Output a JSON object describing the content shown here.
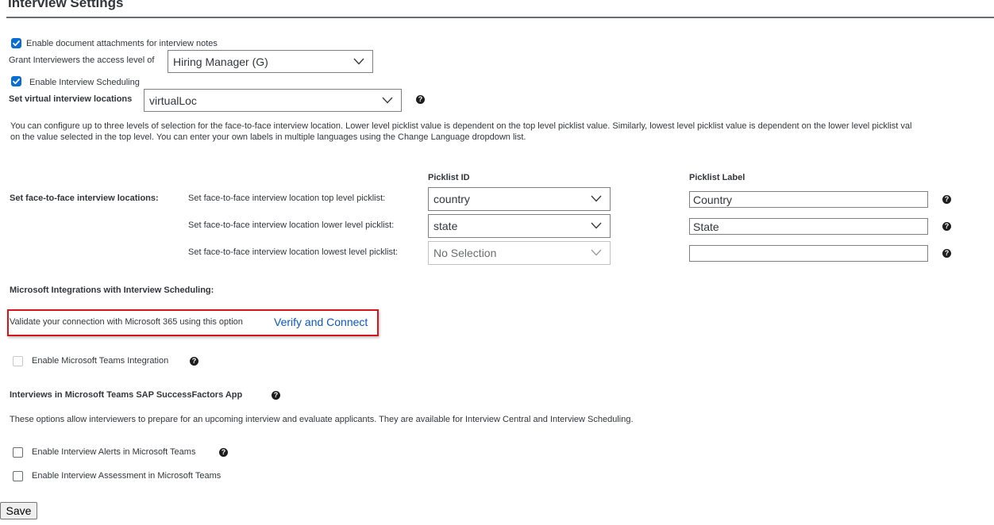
{
  "page": {
    "title": "Interview Settings"
  },
  "settings": {
    "doc_attachments_label": "Enable document attachments for interview notes",
    "grant_label": "Grant Interviewers the access level of",
    "grant_value": "Hiring Manager (G)",
    "scheduling_label": "Enable Interview Scheduling",
    "virtual_label": "Set virtual interview locations",
    "virtual_value": "virtualLoc",
    "info_line1": "You can configure up to three levels of selection for the face-to-face interview location. Lower level picklist value is dependent on the top level picklist value. Similarly, lowest level picklist value is dependent on the lower level picklist val",
    "info_line2": "on the value selected in the top level. You can enter your own labels in multiple languages using the Change Language dropdown list."
  },
  "picklists": {
    "header_id": "Picklist ID",
    "header_label": "Picklist Label",
    "section_label": "Set face-to-face interview locations:",
    "rows": [
      {
        "label": "Set face-to-face interview location top level picklist:",
        "id_value": "country",
        "label_value": "Country"
      },
      {
        "label": "Set face-to-face interview location lower level picklist:",
        "id_value": "state",
        "label_value": "State"
      },
      {
        "label": "Set face-to-face interview location lowest level picklist:",
        "id_value": "No Selection",
        "label_value": ""
      }
    ]
  },
  "microsoft": {
    "heading": "Microsoft Integrations with Interview Scheduling:",
    "validate_text": "Validate your connection with Microsoft 365 using this option",
    "verify_link": "Verify and Connect",
    "teams_integration_label": "Enable Microsoft Teams Integration"
  },
  "teams_app": {
    "heading": "Interviews in Microsoft Teams SAP SuccessFactors App",
    "description": "These options allow interviewers to prepare for an upcoming interview and evaluate applicants. They are available for Interview Central and Interview Scheduling.",
    "alerts_label": "Enable Interview Alerts in Microsoft Teams",
    "assessment_label": "Enable Interview Assessment in Microsoft Teams"
  },
  "footer": {
    "save_label": "Save"
  },
  "colors": {
    "checkbox_accent": "#0a6ed1",
    "link": "#0a58c2",
    "highlight_border": "#d9131a"
  },
  "icons": {
    "help": "question-circle-icon",
    "dropdown": "chevron-down-icon",
    "check": "checkmark-icon"
  }
}
